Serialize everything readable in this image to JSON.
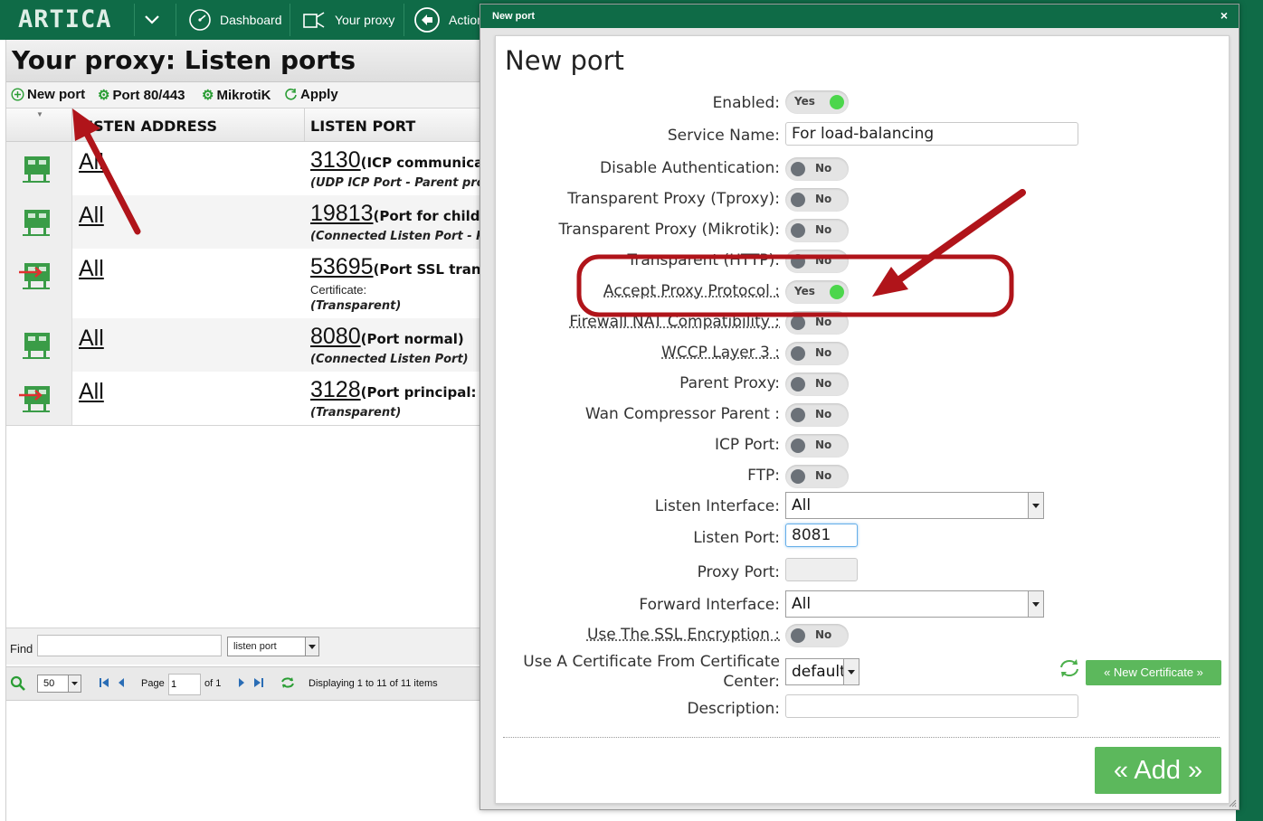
{
  "topbar": {
    "logo": "ARTICA",
    "nav": [
      {
        "label": "Dashboard",
        "icon": "dashboard-icon"
      },
      {
        "label": "Your proxy",
        "icon": "proxy-icon"
      },
      {
        "label": "Actions",
        "icon": "back-arrow-icon"
      }
    ]
  },
  "page": {
    "title": "Your proxy: Listen ports",
    "toolbar": {
      "new_port": "New port",
      "port_80_443": "Port 80/443",
      "mikrotik": "MikrotiK",
      "apply": "Apply"
    },
    "columns": {
      "listen_address": "LISTEN ADDRESS",
      "listen_port": "LISTEN PORT"
    },
    "rows": [
      {
        "address": "All",
        "port": "3130",
        "desc": "(ICP communication",
        "sub": "(UDP ICP Port - Parent proxy)",
        "cert": "",
        "type": "normal"
      },
      {
        "address": "All",
        "port": "19813",
        "desc": "(Port for childs",
        "sub": "(Connected Listen Port - Parent",
        "cert": "",
        "type": "normal"
      },
      {
        "address": "All",
        "port": "53695",
        "desc": "(Port SSL transparent",
        "sub": "(Transparent)",
        "cert": "Certificate:",
        "type": "transparent"
      },
      {
        "address": "All",
        "port": "8080",
        "desc": "(Port normal)",
        "sub": "(Connected Listen Port)",
        "cert": "",
        "type": "normal"
      },
      {
        "address": "All",
        "port": "3128",
        "desc": "(Port principal: M",
        "sub": "(Transparent)",
        "cert": "",
        "type": "transparent"
      }
    ],
    "find": {
      "label": "Find",
      "value": "",
      "field_select": "listen port"
    },
    "pager": {
      "page_size": "50",
      "page_label": "Page",
      "page_value": "1",
      "of": "of 1",
      "status": "Displaying 1 to 11 of 11 items"
    }
  },
  "modal": {
    "window_title": "New port",
    "close": "×",
    "form_title": "New port",
    "fields": {
      "enabled": {
        "label": "Enabled:",
        "value": "Yes"
      },
      "service_name": {
        "label": "Service Name:",
        "value": "For load-balancing"
      },
      "disable_auth": {
        "label": "Disable Authentication:",
        "value": "No"
      },
      "tproxy": {
        "label": "Transparent Proxy (Tproxy):",
        "value": "No"
      },
      "mikrotik": {
        "label": "Transparent Proxy (Mikrotik):",
        "value": "No"
      },
      "transparent_https": {
        "label": "Transparent (HTTP):",
        "value": "No"
      },
      "accept_proxy_protocol": {
        "label": "Accept Proxy Protocol :",
        "value": "Yes"
      },
      "firewall_nat": {
        "label": "Firewall NAT Compatibility :",
        "value": "No"
      },
      "wccp": {
        "label": "WCCP Layer 3 :",
        "value": "No"
      },
      "parent_proxy": {
        "label": "Parent Proxy:",
        "value": "No"
      },
      "wan_compressor": {
        "label": "Wan Compressor Parent :",
        "value": "No"
      },
      "icp_port": {
        "label": "ICP Port:",
        "value": "No"
      },
      "ftp": {
        "label": "FTP:",
        "value": "No"
      },
      "listen_interface": {
        "label": "Listen Interface:",
        "value": "All"
      },
      "listen_port": {
        "label": "Listen Port:",
        "value": "8081"
      },
      "proxy_port": {
        "label": "Proxy Port:",
        "value": ""
      },
      "forward_interface": {
        "label": "Forward Interface:",
        "value": "All"
      },
      "ssl": {
        "label": "Use The SSL Encryption :",
        "value": "No"
      },
      "certificate": {
        "label_line1": "Use A Certificate From Certificate",
        "label_line2": "Center:",
        "value": "default"
      },
      "description": {
        "label": "Description:",
        "value": ""
      }
    },
    "new_certificate_button": "« New Certificate »",
    "add_button": "« Add »"
  },
  "colors": {
    "brand_green": "#0f6b47",
    "button_green": "#5cb85c",
    "annotation_red": "#b0141a",
    "toggle_on": "#4cd64c"
  }
}
